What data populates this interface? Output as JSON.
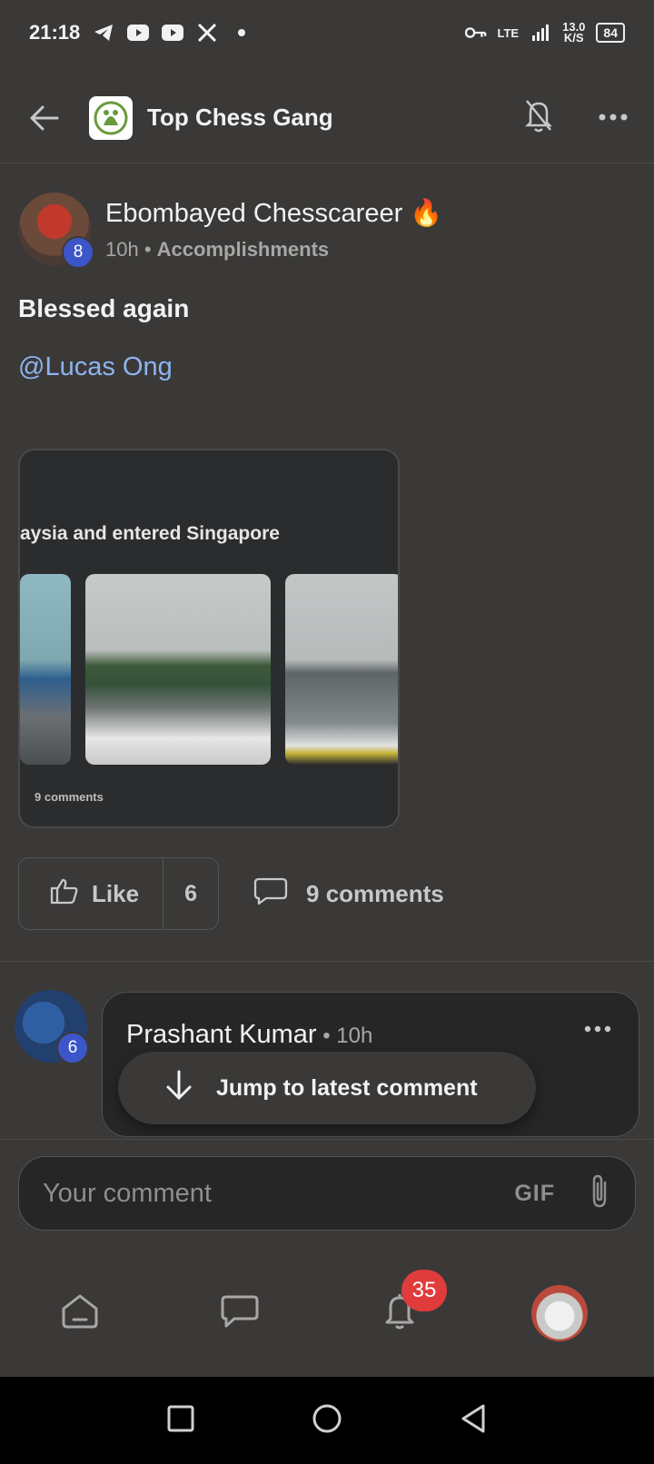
{
  "status_bar": {
    "time": "21:18",
    "network": "LTE",
    "speed_value": "13.0",
    "speed_unit": "K/S",
    "battery": "84"
  },
  "header": {
    "title": "Top Chess Gang",
    "icons": [
      "back-arrow-icon",
      "bell-off-icon",
      "more-icon"
    ]
  },
  "post": {
    "author": "Ebombayed Chesscareer 🔥",
    "author_badge": "8",
    "time": "10h",
    "separator": "•",
    "category": "Accomplishments",
    "title": "Blessed again",
    "mention": "@Lucas Ong",
    "image": {
      "caption": "aysia and entered Singapore",
      "comments_text": "9 comments"
    },
    "like_label": "Like",
    "like_count": "6",
    "comments_label": "9 comments"
  },
  "comment": {
    "author": "Prashant Kumar",
    "author_badge": "6",
    "time": " • 10h"
  },
  "jump_pill": {
    "label": "Jump to latest comment"
  },
  "composer": {
    "placeholder": "Your comment",
    "gif_label": "GIF"
  },
  "bottom_nav": {
    "notification_count": "35",
    "items": [
      "home-icon",
      "chat-icon",
      "bell-icon",
      "profile-avatar"
    ]
  },
  "colors": {
    "background": "#3a3938",
    "mention": "#8eb3f0",
    "badge_blue": "#3c55c8",
    "notification_red": "#e03c3c"
  }
}
